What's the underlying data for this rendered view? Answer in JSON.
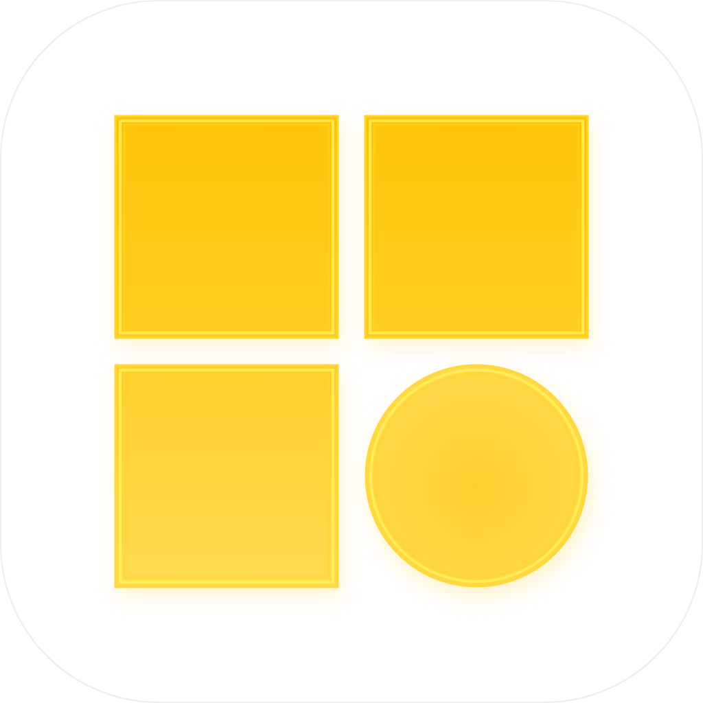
{
  "app_icon": {
    "background_color": "#FFFFFF",
    "outline_color": "#EDEDED",
    "glow_color": "#FFE9A8",
    "tiles": [
      {
        "shape": "square",
        "position_label": "top-left",
        "fill_top": "#FFC20A",
        "fill_bottom": "#FFCC1F",
        "edge": "#FFD62A",
        "highlight": "#FFF25A"
      },
      {
        "shape": "square",
        "position_label": "top-right",
        "fill_top": "#FFC20A",
        "fill_bottom": "#FFCC1F",
        "edge": "#FFD62A",
        "highlight": "#FFF25A"
      },
      {
        "shape": "square",
        "position_label": "bottom-left",
        "fill_top": "#FFCE2A",
        "fill_bottom": "#FFDA4F",
        "edge": "#FFD83A",
        "highlight": "#FFF25A"
      },
      {
        "shape": "circle",
        "position_label": "bottom-right",
        "fill_top": "#FFCE2A",
        "fill_bottom": "#FFDA4F",
        "edge": "#FFD83A",
        "highlight": "#FFF25A"
      }
    ]
  }
}
